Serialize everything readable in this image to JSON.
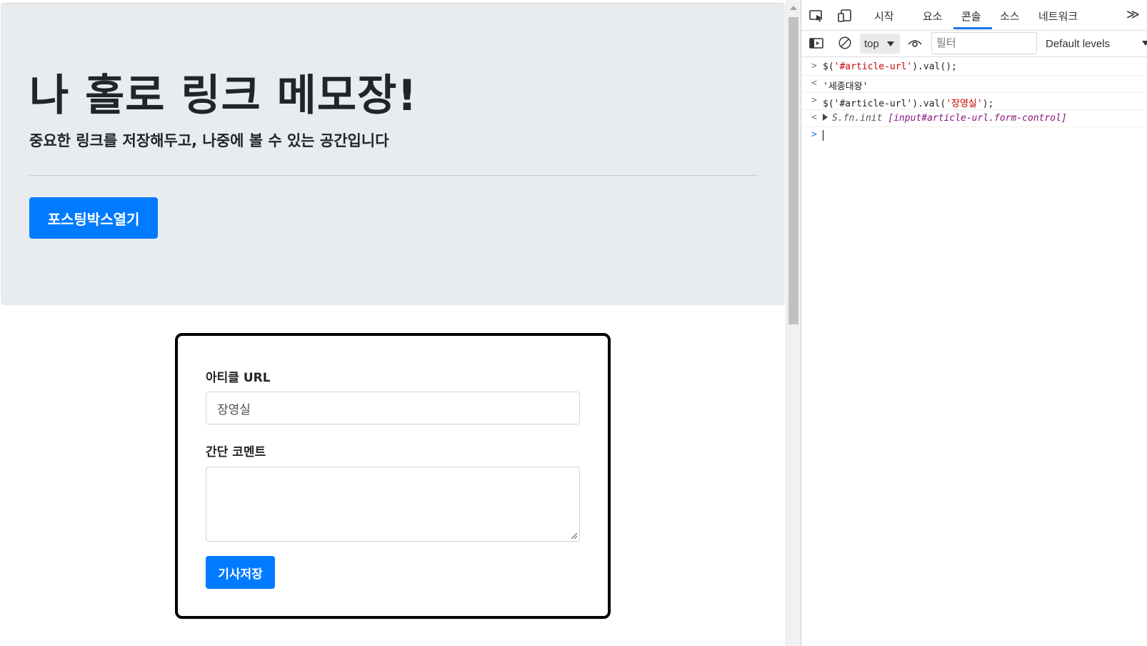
{
  "jumbotron": {
    "title": "나 홀로 링크 메모장!",
    "subtitle": "중요한 링크를 저장해두고, 나중에 볼 수 있는 공간입니다",
    "open_button": "포스팅박스열기"
  },
  "form": {
    "url_label": "아티클 URL",
    "url_value": "장영실",
    "comment_label": "간단 코멘트",
    "comment_value": "",
    "save_button": "기사저장"
  },
  "devtools": {
    "tabs": [
      "시작",
      "요소",
      "콘솔",
      "소스",
      "네트워크"
    ],
    "active_tab": "콘솔",
    "more": "≫",
    "context": "top",
    "filter_placeholder": "필터",
    "levels": "Default levels",
    "console": [
      {
        "gutter": ">",
        "code_prefix": "$(",
        "code_str": "'#article-url'",
        "code_suffix": ").val();"
      },
      {
        "gutter": "<",
        "result": "'세종대왕'"
      },
      {
        "gutter": ">",
        "code_prefix": "$('#article-url').val(",
        "code_str": "'장영실'",
        "code_suffix": ");"
      },
      {
        "gutter": "<",
        "obj_name": "S.fn.init",
        "obj_detail": "[input#article-url.form-control]"
      },
      {
        "gutter": ">"
      }
    ]
  }
}
